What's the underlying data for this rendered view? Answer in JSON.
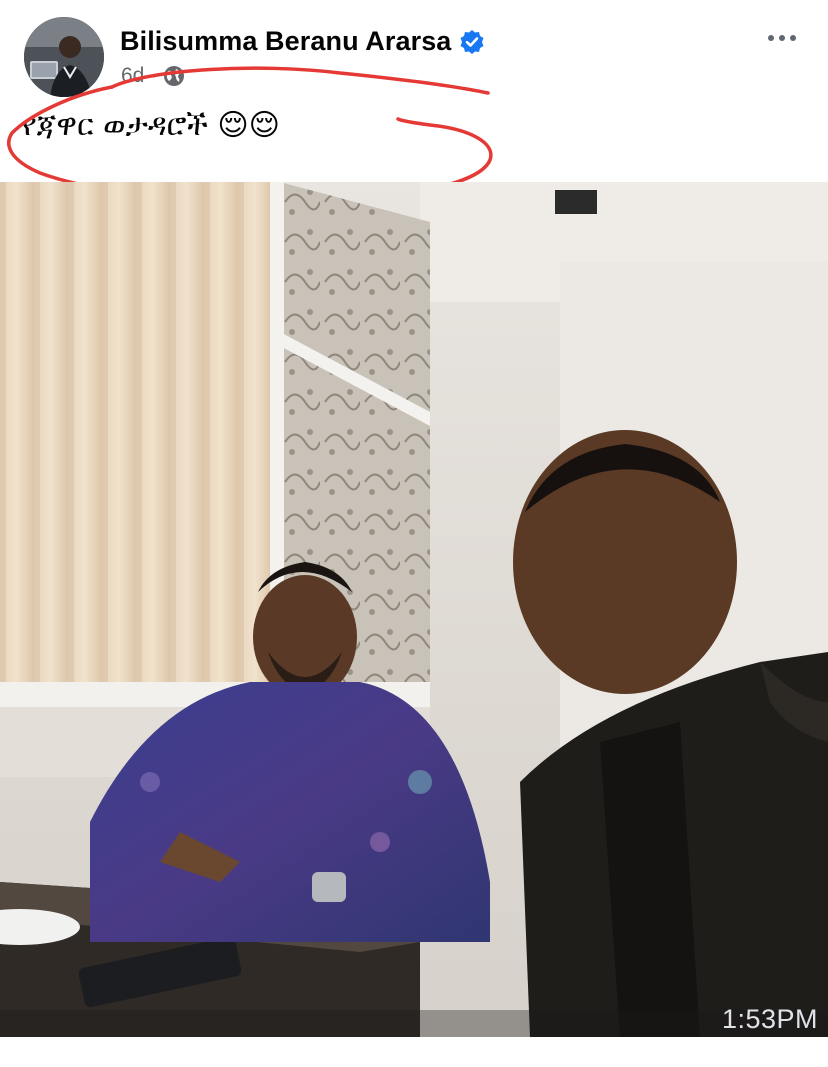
{
  "post": {
    "author": "Bilisumma Beranu Ararsa",
    "time": "6d",
    "separator": "·",
    "text": "የጃዋር ወታዳሮች 😌😌",
    "icons": {
      "avatar": "profile-avatar",
      "verified": "verified-badge-icon",
      "privacy": "globe-icon",
      "menu": "more-options-icon"
    },
    "accent_color": "#1877f2",
    "annotation_color": "#e53935"
  },
  "photo": {
    "timestamp": "1:53PM"
  }
}
